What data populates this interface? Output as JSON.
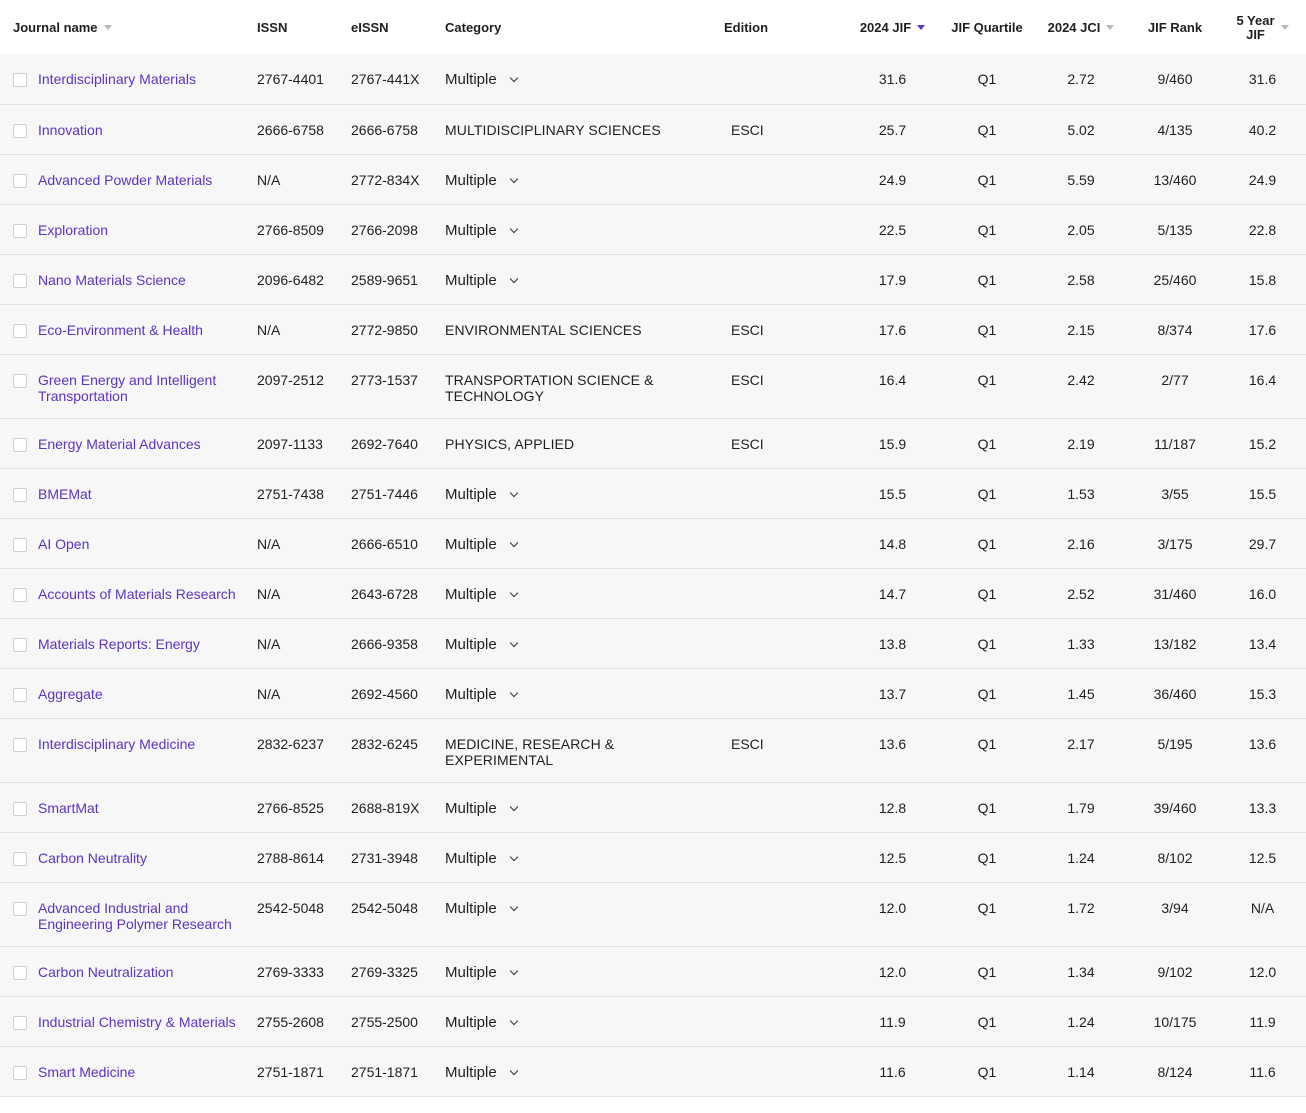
{
  "columns": {
    "journal_name": "Journal name",
    "issn": "ISSN",
    "eissn": "eISSN",
    "category": "Category",
    "edition": "Edition",
    "jif": "2024 JIF",
    "quartile": "JIF Quartile",
    "jci": "2024 JCI",
    "rank": "JIF Rank",
    "five_year_line1": "5 Year",
    "five_year_line2": "JIF"
  },
  "rows": [
    {
      "name": "Interdisciplinary Materials",
      "issn": "2767-4401",
      "eissn": "2767-441X",
      "category": "Multiple",
      "multiple": true,
      "edition": "",
      "jif": "31.6",
      "quartile": "Q1",
      "jci": "2.72",
      "rank": "9/460",
      "five_year": "31.6"
    },
    {
      "name": "Innovation",
      "issn": "2666-6758",
      "eissn": "2666-6758",
      "category": "MULTIDISCIPLINARY SCIENCES",
      "multiple": false,
      "edition": "ESCI",
      "jif": "25.7",
      "quartile": "Q1",
      "jci": "5.02",
      "rank": "4/135",
      "five_year": "40.2"
    },
    {
      "name": "Advanced Powder Materials",
      "issn": "N/A",
      "eissn": "2772-834X",
      "category": "Multiple",
      "multiple": true,
      "edition": "",
      "jif": "24.9",
      "quartile": "Q1",
      "jci": "5.59",
      "rank": "13/460",
      "five_year": "24.9"
    },
    {
      "name": "Exploration",
      "issn": "2766-8509",
      "eissn": "2766-2098",
      "category": "Multiple",
      "multiple": true,
      "edition": "",
      "jif": "22.5",
      "quartile": "Q1",
      "jci": "2.05",
      "rank": "5/135",
      "five_year": "22.8"
    },
    {
      "name": "Nano Materials Science",
      "issn": "2096-6482",
      "eissn": "2589-9651",
      "category": "Multiple",
      "multiple": true,
      "edition": "",
      "jif": "17.9",
      "quartile": "Q1",
      "jci": "2.58",
      "rank": "25/460",
      "five_year": "15.8"
    },
    {
      "name": "Eco-Environment & Health",
      "issn": "N/A",
      "eissn": "2772-9850",
      "category": "ENVIRONMENTAL SCIENCES",
      "multiple": false,
      "edition": "ESCI",
      "jif": "17.6",
      "quartile": "Q1",
      "jci": "2.15",
      "rank": "8/374",
      "five_year": "17.6"
    },
    {
      "name": "Green Energy and Intelligent Transportation",
      "issn": "2097-2512",
      "eissn": "2773-1537",
      "category": "TRANSPORTATION SCIENCE & TECHNOLOGY",
      "multiple": false,
      "edition": "ESCI",
      "jif": "16.4",
      "quartile": "Q1",
      "jci": "2.42",
      "rank": "2/77",
      "five_year": "16.4"
    },
    {
      "name": "Energy Material Advances",
      "issn": "2097-1133",
      "eissn": "2692-7640",
      "category": "PHYSICS, APPLIED",
      "multiple": false,
      "edition": "ESCI",
      "jif": "15.9",
      "quartile": "Q1",
      "jci": "2.19",
      "rank": "11/187",
      "five_year": "15.2"
    },
    {
      "name": "BMEMat",
      "issn": "2751-7438",
      "eissn": "2751-7446",
      "category": "Multiple",
      "multiple": true,
      "edition": "",
      "jif": "15.5",
      "quartile": "Q1",
      "jci": "1.53",
      "rank": "3/55",
      "five_year": "15.5"
    },
    {
      "name": "AI Open",
      "issn": "N/A",
      "eissn": "2666-6510",
      "category": "Multiple",
      "multiple": true,
      "edition": "",
      "jif": "14.8",
      "quartile": "Q1",
      "jci": "2.16",
      "rank": "3/175",
      "five_year": "29.7"
    },
    {
      "name": "Accounts of Materials Research",
      "issn": "N/A",
      "eissn": "2643-6728",
      "category": "Multiple",
      "multiple": true,
      "edition": "",
      "jif": "14.7",
      "quartile": "Q1",
      "jci": "2.52",
      "rank": "31/460",
      "five_year": "16.0"
    },
    {
      "name": "Materials Reports: Energy",
      "issn": "N/A",
      "eissn": "2666-9358",
      "category": "Multiple",
      "multiple": true,
      "edition": "",
      "jif": "13.8",
      "quartile": "Q1",
      "jci": "1.33",
      "rank": "13/182",
      "five_year": "13.4"
    },
    {
      "name": "Aggregate",
      "issn": "N/A",
      "eissn": "2692-4560",
      "category": "Multiple",
      "multiple": true,
      "edition": "",
      "jif": "13.7",
      "quartile": "Q1",
      "jci": "1.45",
      "rank": "36/460",
      "five_year": "15.3"
    },
    {
      "name": "Interdisciplinary Medicine",
      "issn": "2832-6237",
      "eissn": "2832-6245",
      "category": "MEDICINE, RESEARCH & EXPERIMENTAL",
      "multiple": false,
      "edition": "ESCI",
      "jif": "13.6",
      "quartile": "Q1",
      "jci": "2.17",
      "rank": "5/195",
      "five_year": "13.6"
    },
    {
      "name": "SmartMat",
      "issn": "2766-8525",
      "eissn": "2688-819X",
      "category": "Multiple",
      "multiple": true,
      "edition": "",
      "jif": "12.8",
      "quartile": "Q1",
      "jci": "1.79",
      "rank": "39/460",
      "five_year": "13.3"
    },
    {
      "name": "Carbon Neutrality",
      "issn": "2788-8614",
      "eissn": "2731-3948",
      "category": "Multiple",
      "multiple": true,
      "edition": "",
      "jif": "12.5",
      "quartile": "Q1",
      "jci": "1.24",
      "rank": "8/102",
      "five_year": "12.5"
    },
    {
      "name": "Advanced Industrial and Engineering Polymer Research",
      "issn": "2542-5048",
      "eissn": "2542-5048",
      "category": "Multiple",
      "multiple": true,
      "edition": "",
      "jif": "12.0",
      "quartile": "Q1",
      "jci": "1.72",
      "rank": "3/94",
      "five_year": "N/A"
    },
    {
      "name": "Carbon Neutralization",
      "issn": "2769-3333",
      "eissn": "2769-3325",
      "category": "Multiple",
      "multiple": true,
      "edition": "",
      "jif": "12.0",
      "quartile": "Q1",
      "jci": "1.34",
      "rank": "9/102",
      "five_year": "12.0"
    },
    {
      "name": "Industrial Chemistry & Materials",
      "issn": "2755-2608",
      "eissn": "2755-2500",
      "category": "Multiple",
      "multiple": true,
      "edition": "",
      "jif": "11.9",
      "quartile": "Q1",
      "jci": "1.24",
      "rank": "10/175",
      "five_year": "11.9"
    },
    {
      "name": "Smart Medicine",
      "issn": "2751-1871",
      "eissn": "2751-1871",
      "category": "Multiple",
      "multiple": true,
      "edition": "",
      "jif": "11.6",
      "quartile": "Q1",
      "jci": "1.14",
      "rank": "8/124",
      "five_year": "11.6"
    }
  ],
  "tall_rows": [
    6,
    13,
    16
  ],
  "icons": {
    "sort": "sort-caret-icon",
    "expand": "chevron-down-icon",
    "select": "checkbox-icon"
  },
  "colors": {
    "link": "#5e33bf",
    "sort_active": "#5e33bf",
    "row_bg": "#f7f7f7",
    "divider": "#e2e2e2"
  }
}
